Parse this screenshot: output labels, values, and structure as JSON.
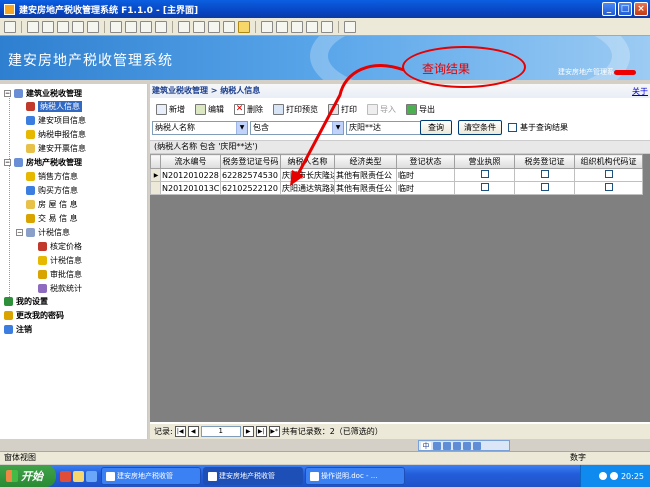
{
  "window": {
    "title": "建安房地产税收管理系统 F1.1.0 - [主界面]"
  },
  "banner": {
    "title": "建安房地产税收管理系统",
    "welcome": "建安房地产管理系"
  },
  "annotation": {
    "text": "查询结果",
    "color": "#e60000"
  },
  "help_link": "关于",
  "sidebar": {
    "groups": [
      {
        "label": "建筑业税收管理",
        "items": [
          "纳税人信息",
          "建安项目信息",
          "纳税申报信息",
          "建安开票信息"
        ]
      },
      {
        "label": "房地产税收管理",
        "items": [
          "销售方信息",
          "购买方信息",
          "房 屋 信 息",
          "交 易 信 息"
        ]
      },
      {
        "label": "计税信息",
        "items": [
          "核定价格",
          "计税信息",
          "审批信息",
          "税款统计"
        ]
      }
    ],
    "bottom": [
      "我的设置",
      "更改我的密码",
      "注销"
    ],
    "selected": "纳税人信息"
  },
  "breadcrumb": "建筑业税收管理 > 纳税人信息",
  "actions": {
    "add": "新增",
    "edit": "编辑",
    "delete": "删除",
    "print_preview": "打印预览",
    "print": "打印",
    "import": "导入",
    "export": "导出"
  },
  "filter": {
    "field": "纳税人名称",
    "operator": "包含",
    "value": "庆阳**达",
    "query_button": "查询",
    "clear_button": "清空条件",
    "base_on_result": "基于查询结果"
  },
  "query_text": "(纳税人名称 包含 '庆阳**达')",
  "table": {
    "columns": [
      "",
      "流水编号",
      "税务登记证号码",
      "纳税人名称",
      "经济类型",
      "登记状态",
      "营业执照",
      "税务登记证",
      "组织机构代码证"
    ],
    "rows": [
      {
        "id": "N2012010228",
        "tax_no": "62282574530",
        "name": "庆阳市长庆隆达",
        "type": "其他有限责任公",
        "status": "临时"
      },
      {
        "id": "N201201013C",
        "tax_no": "62102522120",
        "name": "庆阳通达筑路建",
        "type": "其他有限责任公",
        "status": "临时"
      }
    ]
  },
  "pager": {
    "label": "记录:",
    "page": "1",
    "total": "共有记录数：2（已筛选的）"
  },
  "statusbar": {
    "left": "窗体视图",
    "right": "数字"
  },
  "taskbar": {
    "start": "开始",
    "tasks": [
      "建安房地产税收管",
      "建安房地产税收管",
      "操作说明.doc - ..."
    ],
    "clock": "20:25"
  }
}
